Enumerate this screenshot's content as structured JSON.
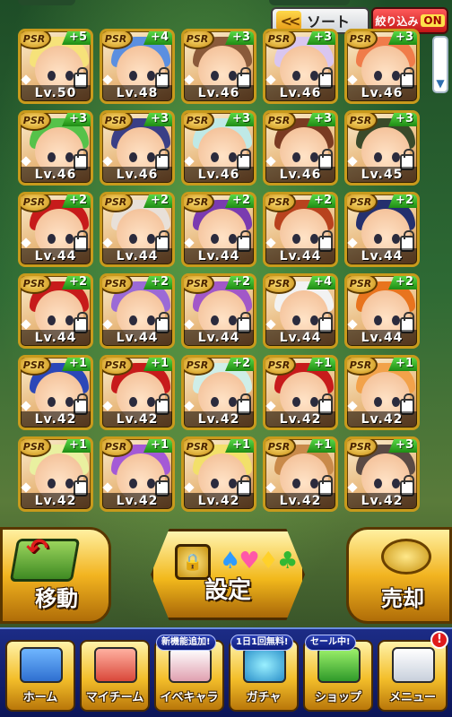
{
  "toolbar": {
    "sort_label": "ソート",
    "sort_chevron": "<<",
    "filter_label": "絞り込み",
    "filter_state": "ON"
  },
  "cards": [
    {
      "rarity": "PSR",
      "plus": "+5",
      "level": "Lv.50",
      "hair": "#f6e27a"
    },
    {
      "rarity": "PSR",
      "plus": "+4",
      "level": "Lv.48",
      "hair": "#5b8fe0"
    },
    {
      "rarity": "PSR",
      "plus": "+3",
      "level": "Lv.46",
      "hair": "#8a5a3a"
    },
    {
      "rarity": "PSR",
      "plus": "+3",
      "level": "Lv.46",
      "hair": "#d9c6f0"
    },
    {
      "rarity": "PSR",
      "plus": "+3",
      "level": "Lv.46",
      "hair": "#f07c4a"
    },
    {
      "rarity": "PSR",
      "plus": "+3",
      "level": "Lv.46",
      "hair": "#55c24a"
    },
    {
      "rarity": "PSR",
      "plus": "+3",
      "level": "Lv.46",
      "hair": "#3a3f86"
    },
    {
      "rarity": "PSR",
      "plus": "+3",
      "level": "Lv.46",
      "hair": "#bfe9e6"
    },
    {
      "rarity": "PSR",
      "plus": "+3",
      "level": "Lv.46",
      "hair": "#7a3b22"
    },
    {
      "rarity": "PSR",
      "plus": "+3",
      "level": "Lv.45",
      "hair": "#3a4a2a"
    },
    {
      "rarity": "PSR",
      "plus": "+2",
      "level": "Lv.44",
      "hair": "#c71b1b"
    },
    {
      "rarity": "PSR",
      "plus": "+2",
      "level": "Lv.44",
      "hair": "#e8e0d8"
    },
    {
      "rarity": "PSR",
      "plus": "+2",
      "level": "Lv.44",
      "hair": "#7a3bb0"
    },
    {
      "rarity": "PSR",
      "plus": "+2",
      "level": "Lv.44",
      "hair": "#b8421e"
    },
    {
      "rarity": "PSR",
      "plus": "+2",
      "level": "Lv.44",
      "hair": "#24306e"
    },
    {
      "rarity": "PSR",
      "plus": "+2",
      "level": "Lv.44",
      "hair": "#c71b1b"
    },
    {
      "rarity": "PSR",
      "plus": "+2",
      "level": "Lv.44",
      "hair": "#9b6ad6"
    },
    {
      "rarity": "PSR",
      "plus": "+2",
      "level": "Lv.44",
      "hair": "#a258c8"
    },
    {
      "rarity": "PSR",
      "plus": "+4",
      "level": "Lv.44",
      "hair": "#f2f2f2"
    },
    {
      "rarity": "PSR",
      "plus": "+2",
      "level": "Lv.44",
      "hair": "#e8741e"
    },
    {
      "rarity": "PSR",
      "plus": "+1",
      "level": "Lv.42",
      "hair": "#2b47b8"
    },
    {
      "rarity": "PSR",
      "plus": "+1",
      "level": "Lv.42",
      "hair": "#c71b1b"
    },
    {
      "rarity": "PSR",
      "plus": "+2",
      "level": "Lv.42",
      "hair": "#cfeee8"
    },
    {
      "rarity": "PSR",
      "plus": "+1",
      "level": "Lv.42",
      "hair": "#c71b1b"
    },
    {
      "rarity": "PSR",
      "plus": "+1",
      "level": "Lv.42",
      "hair": "#f2a24a"
    },
    {
      "rarity": "PSR",
      "plus": "+1",
      "level": "Lv.42",
      "hair": "#e9f0a0"
    },
    {
      "rarity": "PSR",
      "plus": "+1",
      "level": "Lv.42",
      "hair": "#a45ad6"
    },
    {
      "rarity": "PSR",
      "plus": "+1",
      "level": "Lv.42",
      "hair": "#f2e06a"
    },
    {
      "rarity": "PSR",
      "plus": "+1",
      "level": "Lv.42",
      "hair": "#c98a4a"
    },
    {
      "rarity": "PSR",
      "plus": "+3",
      "level": "Lv.42",
      "hair": "#5a4a44"
    }
  ],
  "actions": {
    "move_label": "移動",
    "set_label": "設定",
    "sell_label": "売却"
  },
  "nav": {
    "home": "ホーム",
    "my_team": "マイチーム",
    "event_chara": "イベキャラ",
    "gacha": "ガチャ",
    "shop": "ショップ",
    "menu": "メニュー",
    "event_badge": "新機能追加!",
    "gacha_badge": "1日1回無料!",
    "shop_badge": "セール中!",
    "menu_alert": "!"
  }
}
